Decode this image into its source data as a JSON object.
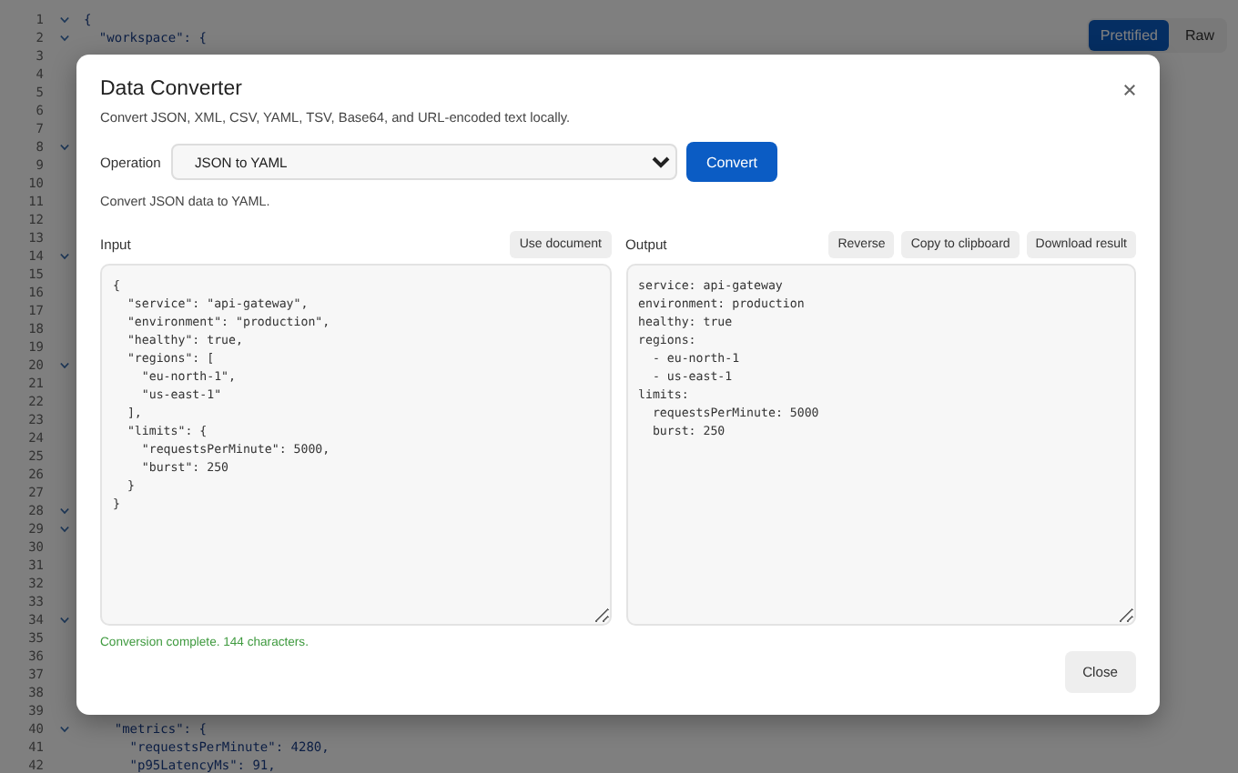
{
  "editor": {
    "view_tabs": [
      {
        "label": "Prettified",
        "selected": true
      },
      {
        "label": "Raw",
        "selected": false
      }
    ],
    "lines": [
      {
        "number": "1",
        "fold": true,
        "text": "{"
      },
      {
        "number": "2",
        "fold": true,
        "text": "  \"workspace\": {"
      },
      {
        "number": "3",
        "fold": false
      },
      {
        "number": "4",
        "fold": false
      },
      {
        "number": "5",
        "fold": false
      },
      {
        "number": "6",
        "fold": false
      },
      {
        "number": "7",
        "fold": false
      },
      {
        "number": "8",
        "fold": true
      },
      {
        "number": "9",
        "fold": false
      },
      {
        "number": "10",
        "fold": false
      },
      {
        "number": "11",
        "fold": false
      },
      {
        "number": "12",
        "fold": false
      },
      {
        "number": "13",
        "fold": false
      },
      {
        "number": "14",
        "fold": true
      },
      {
        "number": "15",
        "fold": false
      },
      {
        "number": "16",
        "fold": false
      },
      {
        "number": "17",
        "fold": false
      },
      {
        "number": "18",
        "fold": false
      },
      {
        "number": "19",
        "fold": false
      },
      {
        "number": "20",
        "fold": true
      },
      {
        "number": "21",
        "fold": false
      },
      {
        "number": "22",
        "fold": false
      },
      {
        "number": "23",
        "fold": false
      },
      {
        "number": "24",
        "fold": false
      },
      {
        "number": "25",
        "fold": false
      },
      {
        "number": "26",
        "fold": false
      },
      {
        "number": "27",
        "fold": false
      },
      {
        "number": "28",
        "fold": true
      },
      {
        "number": "29",
        "fold": true
      },
      {
        "number": "30",
        "fold": false
      },
      {
        "number": "31",
        "fold": false
      },
      {
        "number": "32",
        "fold": false
      },
      {
        "number": "33",
        "fold": false
      },
      {
        "number": "34",
        "fold": true
      },
      {
        "number": "35",
        "fold": false
      },
      {
        "number": "36",
        "fold": false
      },
      {
        "number": "37",
        "fold": false
      },
      {
        "number": "38",
        "fold": false
      },
      {
        "number": "39",
        "fold": false
      },
      {
        "number": "40",
        "fold": true,
        "text": "    \"metrics\": {"
      },
      {
        "number": "41",
        "fold": false,
        "text": "      \"requestsPerMinute\": 4280,"
      },
      {
        "number": "42",
        "fold": false,
        "text": "      \"p95LatencyMs\": 91,"
      }
    ]
  },
  "dialog": {
    "title": "Data Converter",
    "subtitle": "Convert JSON, XML, CSV, YAML, TSV, Base64, and URL-encoded text locally.",
    "operation_label": "Operation",
    "operation": "JSON to YAML",
    "convert_button": "Convert",
    "hint": "Convert JSON data to YAML.",
    "input": {
      "label": "Input",
      "buttons": [
        "Use document"
      ],
      "value": "{\n  \"service\": \"api-gateway\",\n  \"environment\": \"production\",\n  \"healthy\": true,\n  \"regions\": [\n    \"eu-north-1\",\n    \"us-east-1\"\n  ],\n  \"limits\": {\n    \"requestsPerMinute\": 5000,\n    \"burst\": 250\n  }\n}"
    },
    "output": {
      "label": "Output",
      "buttons": [
        "Reverse",
        "Copy to clipboard",
        "Download result"
      ],
      "value": "service: api-gateway\nenvironment: production\nhealthy: true\nregions:\n  - eu-north-1\n  - us-east-1\nlimits:\n  requestsPerMinute: 5000\n  burst: 250"
    },
    "status": "Conversion complete. 144 characters.",
    "close_button": "Close"
  }
}
